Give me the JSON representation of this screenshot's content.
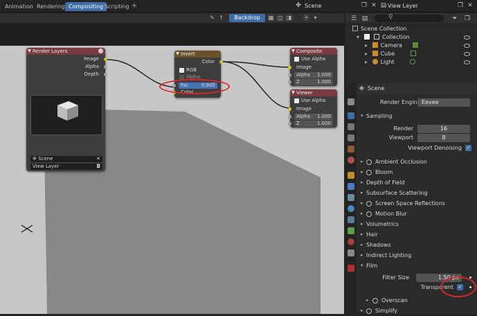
{
  "workspaces": {
    "tabs": [
      "Animation",
      "Rendering",
      "Compositing",
      "Scripting"
    ],
    "active": "Compositing",
    "scene": "Scene",
    "view_layer": "View Layer"
  },
  "node_editor": {
    "backdrop_label": "Backdrop",
    "nodes": {
      "render_layers": {
        "title": "Render Layers",
        "outputs": [
          "Image",
          "Alpha",
          "Depth"
        ],
        "scene": "Scene",
        "layer": "View Layer"
      },
      "invert": {
        "title": "Invert",
        "output": "Color",
        "rgb_label": "RGB",
        "alpha_label": "Alpha",
        "fac_label": "Fac",
        "fac_value": "0.805",
        "color_label": "Color"
      },
      "composite": {
        "title": "Composite",
        "use_alpha": "Use Alpha",
        "image": "Image",
        "alpha_label": "Alpha",
        "alpha_value": "1.000",
        "z_label": "Z",
        "z_value": "1.000"
      },
      "viewer": {
        "title": "Viewer",
        "use_alpha": "Use Alpha",
        "image": "Image",
        "alpha_label": "Alpha",
        "alpha_value": "1.000",
        "z_label": "Z",
        "z_value": "1.000"
      }
    }
  },
  "outliner": {
    "root": "Scene Collection",
    "collection": "Collection",
    "items": [
      "Camera",
      "Cube",
      "Light"
    ]
  },
  "properties": {
    "header": "Scene",
    "render_engine_label": "Render Engine",
    "render_engine_value": "Eevee",
    "sampling": "Sampling",
    "render_label": "Render",
    "render_value": "16",
    "viewport_label": "Viewport",
    "viewport_value": "8",
    "viewport_denoising": "Viewport Denoising",
    "panels": [
      "Ambient Occlusion",
      "Bloom",
      "Depth of Field",
      "Subsurface Scattering",
      "Screen Space Reflections",
      "Motion Blur",
      "Volumetrics",
      "Hair",
      "Shadows",
      "Indirect Lighting"
    ],
    "film": "Film",
    "filter_size_label": "Filter Size",
    "filter_size_value": "1.50 px",
    "transparent_label": "Transparent",
    "overscan": "Overscan",
    "simplify": "Simplify"
  },
  "colors": {
    "accent": "#3f6da8",
    "highlight_ring": "#d8262b",
    "socket_yellow": "#c7c729"
  }
}
